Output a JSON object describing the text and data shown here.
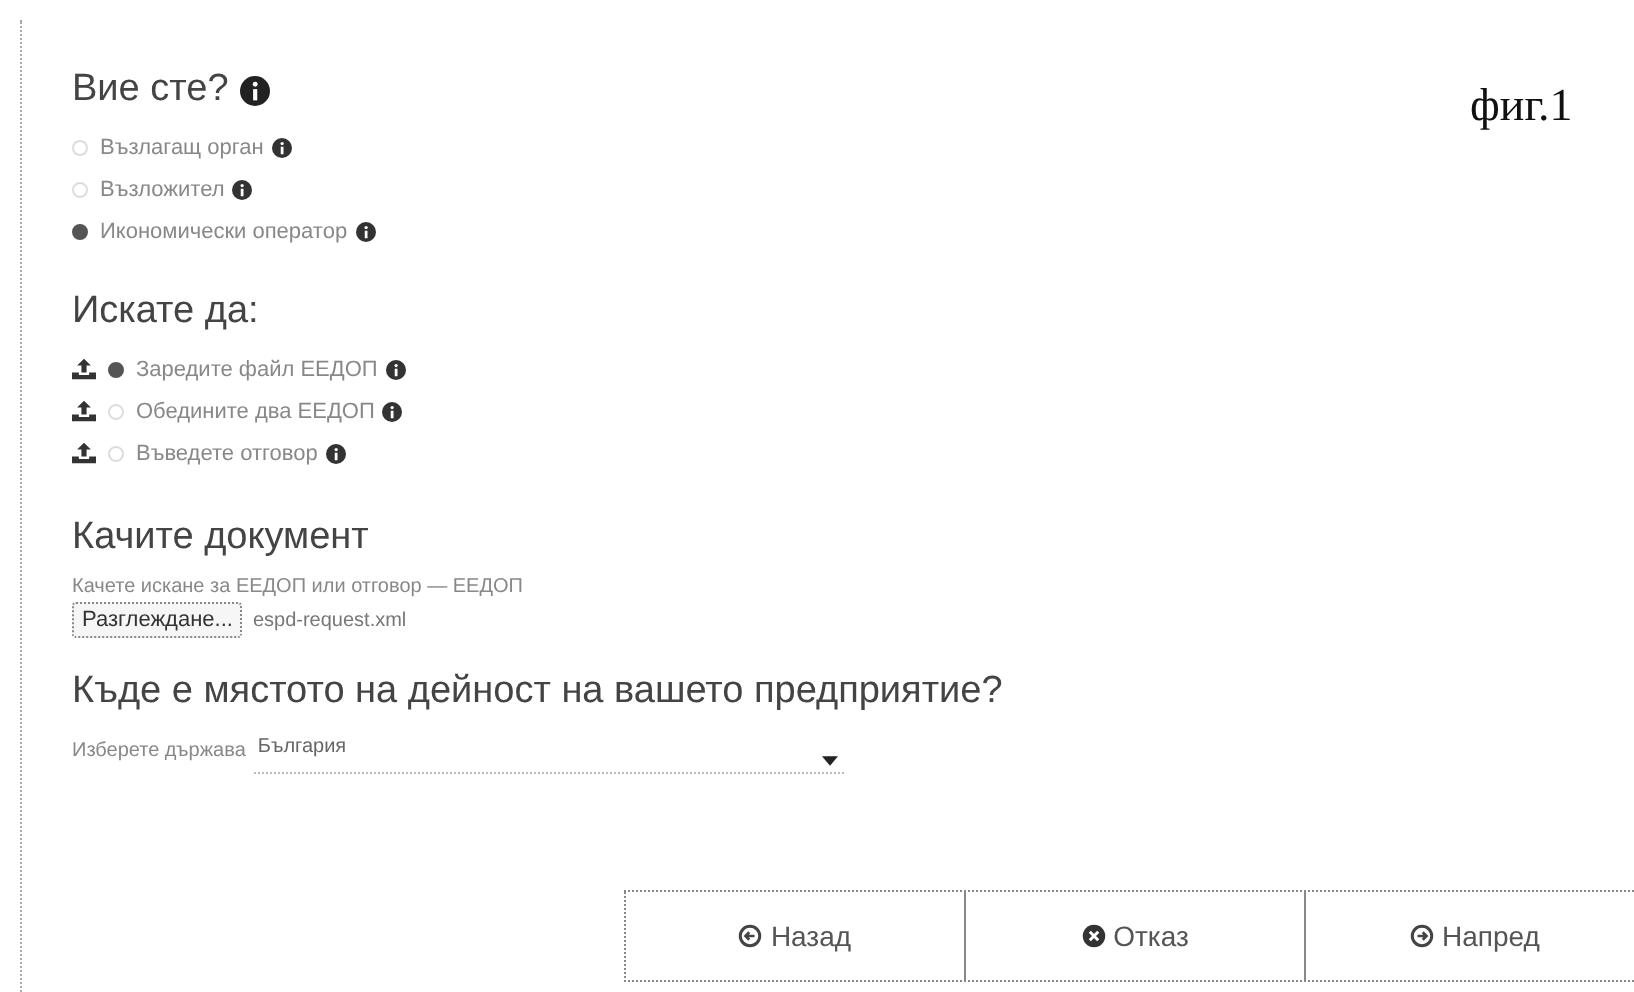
{
  "figure_label": "фиг.1",
  "role": {
    "title": "Вие сте?",
    "options": [
      {
        "label": "Възлагащ орган",
        "selected": false
      },
      {
        "label": "Възложител",
        "selected": false
      },
      {
        "label": "Икономически оператор",
        "selected": true
      }
    ]
  },
  "action": {
    "title": "Искате да:",
    "options": [
      {
        "label": "Заредите файл ЕЕДОП",
        "selected": true
      },
      {
        "label": "Обедините два ЕЕДОП",
        "selected": false
      },
      {
        "label": "Въведете отговор",
        "selected": false
      }
    ]
  },
  "upload": {
    "title": "Качите документ",
    "hint": "Качете искане за ЕЕДОП или отговор — ЕЕДОП",
    "browse_button": "Разглеждане...",
    "file_name": "espd-request.xml"
  },
  "location": {
    "title": "Къде е мястото на дейност на вашето предприятие?",
    "country_label": "Изберете държава",
    "country_value": "България"
  },
  "buttons": [
    {
      "label": "Назад",
      "kind": "back"
    },
    {
      "label": "Отказ",
      "kind": "cancel"
    },
    {
      "label": "Напред",
      "kind": "next"
    }
  ]
}
